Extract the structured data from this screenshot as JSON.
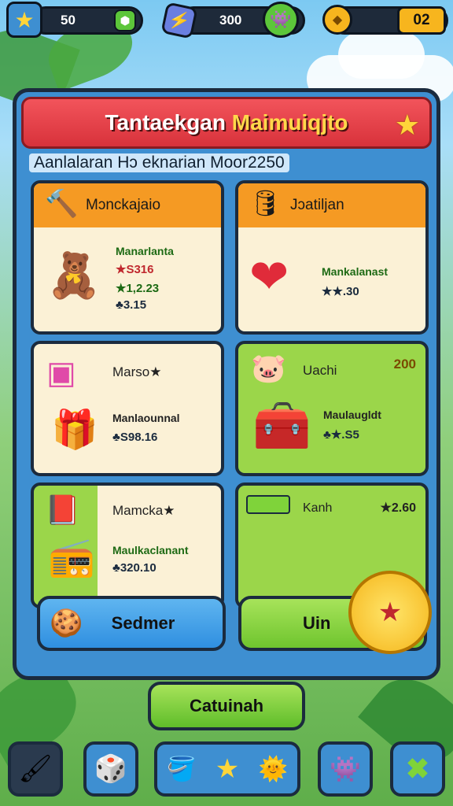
{
  "top_bar": {
    "stars": "50",
    "energy": "300",
    "gems": "02"
  },
  "panel": {
    "title_main": "Tantaekgan",
    "title_highlight": "Maimuiqjto",
    "subtitle": "Aanlalaran Hɔ eknarian Moor2250"
  },
  "cards": [
    {
      "title": "Mɔnckajaio",
      "lines": [
        "Manarlanta",
        "★S316",
        "★1,2.23",
        "♣3.15"
      ]
    },
    {
      "title": "Jɔatiljan",
      "lines": [
        "Mankalanast",
        "★★.30"
      ]
    },
    {
      "title": "Marso★",
      "lines": [
        "Manlaounnal",
        "♣S98.16"
      ]
    },
    {
      "title": "Uachi",
      "badge": "200",
      "lines": [
        "Maulaugldt",
        "♣★.S5"
      ]
    },
    {
      "title": "Mamcka★",
      "lines": [
        "Maulkaclanant",
        "♣320.10"
      ]
    },
    {
      "title": "Kanh",
      "badge": "★2.60",
      "lines": []
    }
  ],
  "buttons": {
    "left": "Sedmer",
    "right": "Uin",
    "main": "Catuinah"
  },
  "colors": {
    "header_red": "#d8323b",
    "card_orange": "#f59a23",
    "card_green": "#9bd64a",
    "button_blue": "#2f8fe0",
    "button_green": "#7fd33a",
    "gold": "#ffd53a"
  }
}
